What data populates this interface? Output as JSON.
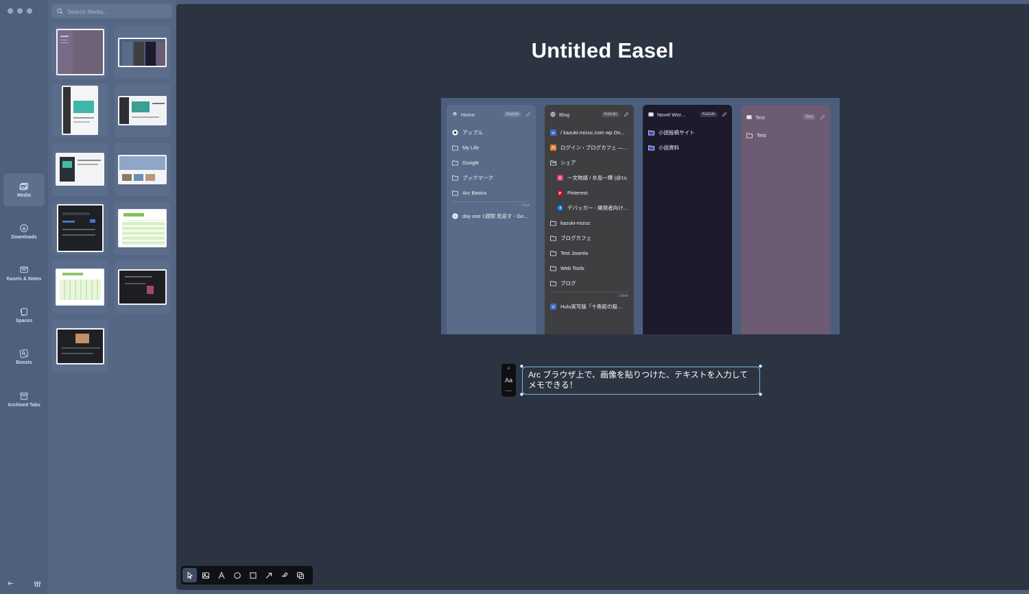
{
  "window": {
    "controls": [
      "close",
      "minimize",
      "zoom"
    ]
  },
  "rail": {
    "items": [
      {
        "label": "Media",
        "icon": "media-icon",
        "active": true
      },
      {
        "label": "Downloads",
        "icon": "download-icon",
        "active": false
      },
      {
        "label": "Easels & Notes",
        "icon": "easel-icon",
        "active": false
      },
      {
        "label": "Spaces",
        "icon": "spaces-icon",
        "active": false
      },
      {
        "label": "Boosts",
        "icon": "boosts-icon",
        "active": false
      },
      {
        "label": "Archived Tabs",
        "icon": "archive-icon",
        "active": false
      }
    ],
    "bottom": [
      {
        "icon": "back-arrow-icon"
      },
      {
        "icon": "gift-icon"
      }
    ]
  },
  "media": {
    "search_placeholder": "Search Media...",
    "thumbnails": [
      {
        "kind": "purple-sidebar"
      },
      {
        "kind": "blue-spaces"
      },
      {
        "kind": "article-light"
      },
      {
        "kind": "webpage-hero"
      },
      {
        "kind": "article-mixed"
      },
      {
        "kind": "blog-banner"
      },
      {
        "kind": "dark-dialog"
      },
      {
        "kind": "green-table"
      },
      {
        "kind": "green-table-small"
      },
      {
        "kind": "dark-site"
      },
      {
        "kind": "dark-video"
      }
    ]
  },
  "easel": {
    "title": "Untitled Easel",
    "screenshot": {
      "spaces": [
        {
          "name": "Home",
          "profile": "Kazuki",
          "bg": "#5a6b89",
          "rows": [
            {
              "icon": "arc-icon",
              "text": "アップル"
            },
            {
              "icon": "folder-icon",
              "text": "My Life"
            },
            {
              "icon": "folder-icon",
              "text": "Google"
            },
            {
              "icon": "folder-icon",
              "text": "ブックマーク"
            },
            {
              "icon": "folder-icon",
              "text": "Arc Basics"
            }
          ],
          "clear": "↓ Clear",
          "tabs": [
            {
              "icon": "google-icon",
              "text": "day one 1週間 見返す - Go..."
            }
          ]
        },
        {
          "name": "Blog",
          "profile": "Kazuki",
          "bg": "#3f3f42",
          "rows": [
            {
              "icon": "wp-icon",
              "text": "/ kazuki-mizuc.com wp On..."
            },
            {
              "icon": "site-icon",
              "text": "ログイン ‹ ブログカフェ —..."
            },
            {
              "icon": "folder-open-icon",
              "text": "シェア"
            },
            {
              "icon": "instagram-icon",
              "text": "一文物語 / 水島一輝 (@1s...",
              "nested": true
            },
            {
              "icon": "pinterest-icon",
              "text": "Pinterest",
              "nested": true
            },
            {
              "icon": "facebook-icon",
              "text": "デバッガー - 開発者向け...",
              "nested": true
            },
            {
              "icon": "folder-icon",
              "text": "kazuki-mizuc"
            },
            {
              "icon": "folder-icon",
              "text": "ブログカフェ"
            },
            {
              "icon": "folder-icon",
              "text": "Test Joomla"
            },
            {
              "icon": "folder-icon",
              "text": "Web Tools"
            },
            {
              "icon": "folder-icon",
              "text": "ブログ"
            }
          ],
          "clear": "↓ Clear",
          "tabs": [
            {
              "icon": "wp-icon",
              "text": "Hulu実写版「十角館の殺..."
            }
          ]
        },
        {
          "name": "Novel Wor...",
          "profile": "Kazuki",
          "bg": "#1d1a2c",
          "rows": [
            {
              "icon": "folder-blue-icon",
              "text": "小説投稿サイト"
            },
            {
              "icon": "folder-blue-icon",
              "text": "小説資料"
            }
          ],
          "clear": "",
          "tabs": []
        },
        {
          "name": "Test",
          "profile": "Test",
          "bg": "#6d5b73",
          "rows": [
            {
              "icon": "folder-icon",
              "text": "Test"
            }
          ],
          "clear": "",
          "tabs": []
        }
      ]
    },
    "note": {
      "text": "Arc ブラウザ上で、画像を貼りつけた、テキストを入力してメモできる！",
      "toolbar": {
        "plus": "+",
        "font": "Aa",
        "minus": "—"
      }
    }
  },
  "tools": [
    {
      "icon": "select-cursor-icon",
      "active": true
    },
    {
      "icon": "image-icon",
      "active": false
    },
    {
      "icon": "text-tool-icon",
      "active": false
    },
    {
      "icon": "circle-tool-icon",
      "active": false
    },
    {
      "icon": "rectangle-tool-icon",
      "active": false
    },
    {
      "icon": "arrow-tool-icon",
      "active": false
    },
    {
      "icon": "draw-tool-icon",
      "active": false
    },
    {
      "icon": "clip-tool-icon",
      "active": false
    }
  ]
}
